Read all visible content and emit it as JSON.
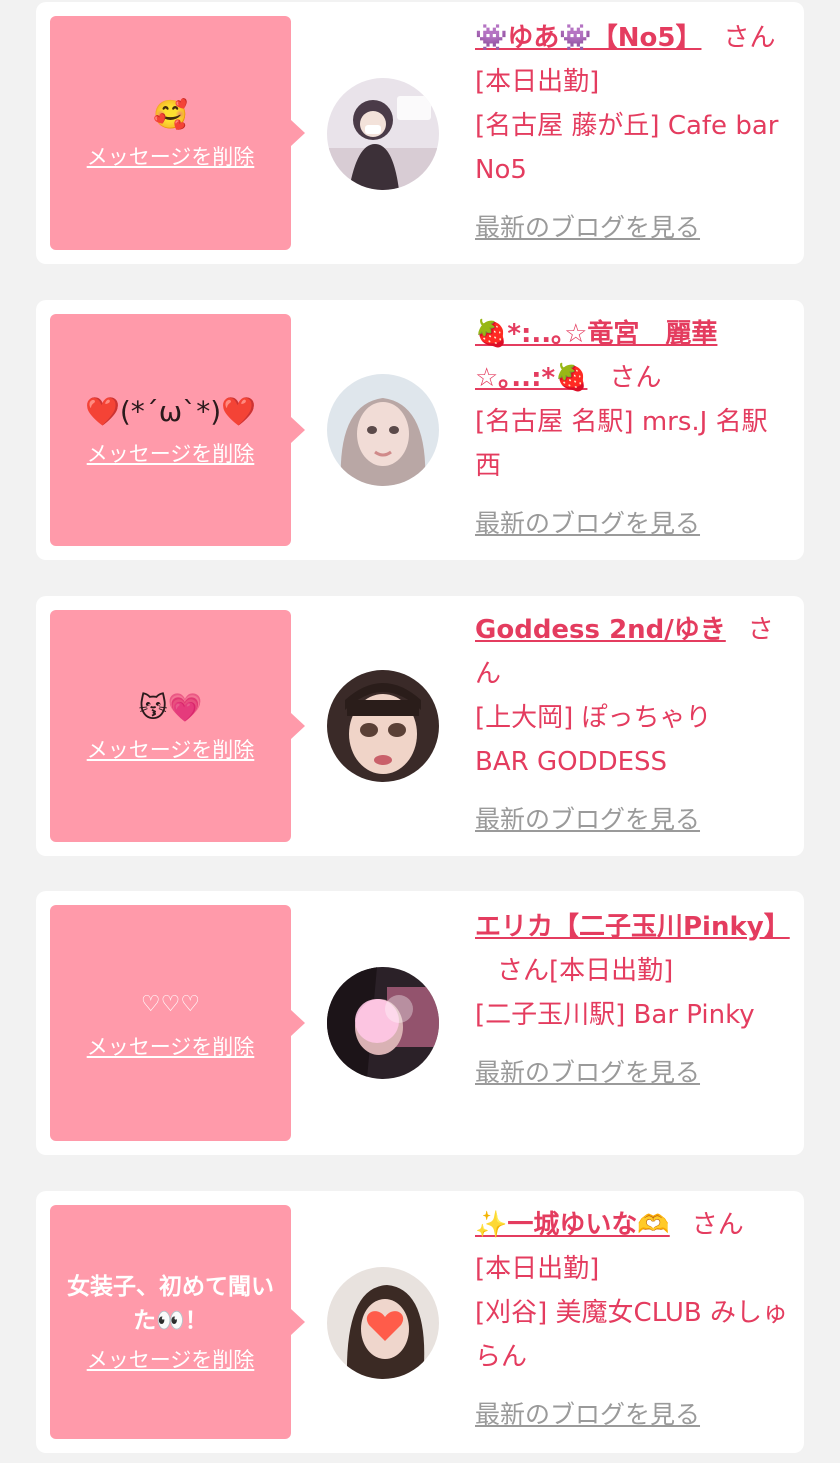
{
  "delete_label": "メッセージを削除",
  "blog_label": "最新のブログを見る",
  "san_suffix": "さん",
  "colors": {
    "accent": "#e43c5f",
    "bubble": "#ff9aaa",
    "background": "#f2f2f2",
    "muted": "#9a9a9a"
  },
  "cards": [
    {
      "message": "🥰",
      "name": "👾ゆあ👾【No5】",
      "status": "[本日出勤]",
      "location": "[名古屋 藤が丘] Cafe bar No5"
    },
    {
      "message": "❤️(*´ω`*)❤️",
      "name": "🍓*:..｡☆竜宮　麗華☆｡..:*🍓",
      "status": "",
      "location": "[名古屋 名駅] mrs.J 名駅西"
    },
    {
      "message": "😽💗",
      "name": "Goddess 2nd/ゆき",
      "status": "",
      "location_line1": "[上大岡] ぽっちゃり",
      "location_line2": "BAR GODDESS"
    },
    {
      "message": "♡♡♡",
      "name": "エリカ【二子玉川Pinky】",
      "status": "[本日出勤]",
      "location": "[二子玉川駅] Bar Pinky"
    },
    {
      "message": "女装子、初めて聞いた👀！",
      "name": "✨一城ゆいな🫶",
      "status": "[本日出勤]",
      "location": "[刈谷] 美魔女CLUB みしゅらん"
    }
  ]
}
